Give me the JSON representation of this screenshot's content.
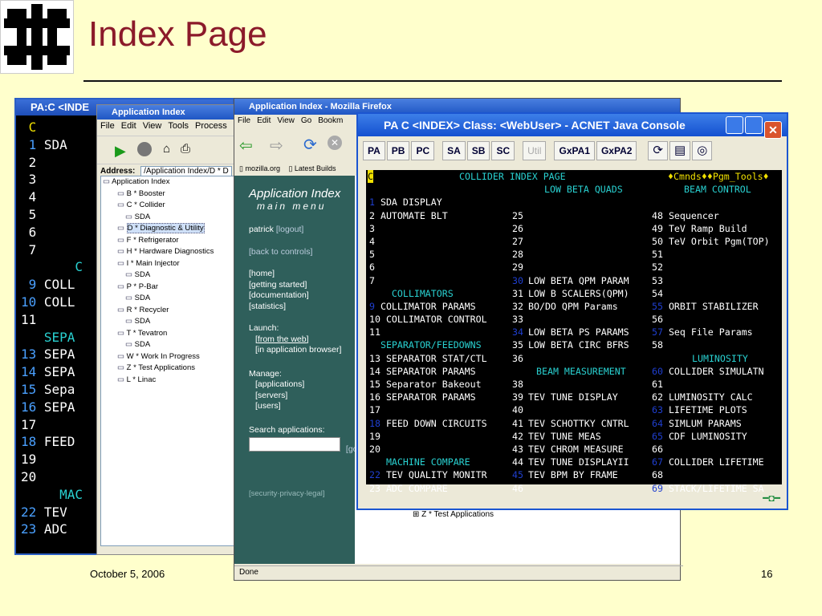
{
  "slide": {
    "title": "Index Page",
    "date": "October 5, 2006",
    "page": "16"
  },
  "console_bg": {
    "title": "PA:C <INDE",
    "lines": [
      {
        "n": "C",
        "t": "",
        "nc": "#f0e000"
      },
      {
        "n": "1",
        "t": " SDA",
        "nc": "#4aa0ff"
      },
      {
        "n": "2",
        "t": "",
        "nc": "#fff"
      },
      {
        "n": "3",
        "t": "",
        "nc": "#fff"
      },
      {
        "n": "4",
        "t": "",
        "nc": "#fff"
      },
      {
        "n": "5",
        "t": "",
        "nc": "#fff"
      },
      {
        "n": "6",
        "t": "",
        "nc": "#fff"
      },
      {
        "n": "7",
        "t": "",
        "nc": "#fff"
      },
      {
        "n": "",
        "t": "       C",
        "nc": "#29d1d1"
      },
      {
        "n": "9",
        "t": " COLL",
        "nc": "#4aa0ff"
      },
      {
        "n": "10",
        "t": " COLL",
        "nc": "#4aa0ff"
      },
      {
        "n": "11",
        "t": "",
        "nc": "#fff"
      },
      {
        "n": "",
        "t": "   SEPA",
        "nc": "#29d1d1"
      },
      {
        "n": "13",
        "t": " SEPA",
        "nc": "#4aa0ff"
      },
      {
        "n": "14",
        "t": " SEPA",
        "nc": "#4aa0ff"
      },
      {
        "n": "15",
        "t": " Sepa",
        "nc": "#4aa0ff"
      },
      {
        "n": "16",
        "t": " SEPA",
        "nc": "#4aa0ff"
      },
      {
        "n": "17",
        "t": "",
        "nc": "#fff"
      },
      {
        "n": "18",
        "t": " FEED",
        "nc": "#4aa0ff"
      },
      {
        "n": "19",
        "t": "",
        "nc": "#fff"
      },
      {
        "n": "20",
        "t": "",
        "nc": "#fff"
      },
      {
        "n": "",
        "t": "     MAC",
        "nc": "#29d1d1"
      },
      {
        "n": "22",
        "t": " TEV",
        "nc": "#4aa0ff"
      },
      {
        "n": "23",
        "t": " ADC",
        "nc": "#4aa0ff"
      }
    ]
  },
  "app_index": {
    "title": "Application Index",
    "menu": [
      "File",
      "Edit",
      "View",
      "Tools",
      "Process"
    ],
    "address_label": "Address:",
    "address_value": "/Application Index/D * D",
    "tree": [
      "Application Index",
      "B * Booster",
      "C * Collider",
      "SDA",
      "D * Diagnostic & Utility",
      "F * Refrigerator",
      "H * Hardware Diagnostics",
      "I * Main Injector",
      "SDA",
      "P * P-Bar",
      "SDA",
      "R * Recycler",
      "SDA",
      "T * Tevatron",
      "SDA",
      "W * Work In Progress",
      "Z * Test Applications",
      "L * Linac"
    ]
  },
  "firefox": {
    "title": "Application Index - Mozilla Firefox",
    "menu": [
      "File",
      "Edit",
      "View",
      "Go",
      "Bookm"
    ],
    "bookmarks": [
      "mozilla.org",
      "Latest Builds"
    ],
    "side_title": "Application Index",
    "side_sub": "main menu",
    "user": "patrick",
    "logout": "[logout]",
    "back": "[back to controls]",
    "links1": [
      "[home]",
      "[getting started]",
      "[documentation]",
      "[statistics]"
    ],
    "launch": "Launch:",
    "launch_links": [
      "[from the web]",
      "[in application browser]"
    ],
    "manage": "Manage:",
    "manage_links": [
      "[applications]",
      "[servers]",
      "[users]"
    ],
    "search": "Search applications:",
    "go": "[go",
    "legal": "[security·privacy·legal]",
    "status": "Done",
    "bottom_item": "Z * Test Applications"
  },
  "acnet": {
    "title": "PA C <INDEX> Class: <WebUser> - ACNET Java Console",
    "buttons": [
      "PA",
      "PB",
      "PC",
      "SA",
      "SB",
      "SC",
      "Util",
      "GxPA1",
      "GxPA2"
    ],
    "header": {
      "c": "C",
      "title": "COLLIDER INDEX PAGE",
      "cmds": "♦Cmnds♦♦Pgm_Tools♦"
    },
    "rows": [
      [
        {
          "t": "",
          "c": "#fff"
        },
        {
          "t": "",
          "c": "#fff"
        },
        {
          "t": "LOW BETA QUADS",
          "c": "#29d1d1"
        },
        {
          "t": "BEAM CONTROL",
          "c": "#29d1d1"
        }
      ],
      [
        {
          "t": "1 SDA DISPLAY",
          "c": "#fff",
          "nb": true
        },
        {
          "t": "",
          "c": "#fff"
        },
        {
          "t": "",
          "c": "#fff"
        },
        {
          "t": "",
          "c": "#fff"
        }
      ],
      [
        {
          "t": "2 AUTOMATE BLT",
          "c": "#fff"
        },
        {
          "t": "25",
          "c": "#fff"
        },
        {
          "t": "",
          "c": "#fff"
        },
        {
          "t": "48 Sequencer",
          "c": "#fff"
        }
      ],
      [
        {
          "t": "3",
          "c": "#fff"
        },
        {
          "t": "26",
          "c": "#fff"
        },
        {
          "t": "",
          "c": "#fff"
        },
        {
          "t": "49 TeV Ramp Build",
          "c": "#fff"
        }
      ],
      [
        {
          "t": "4",
          "c": "#fff"
        },
        {
          "t": "27",
          "c": "#fff"
        },
        {
          "t": "",
          "c": "#fff"
        },
        {
          "t": "50 TeV Orbit Pgm(TOP)",
          "c": "#fff"
        }
      ],
      [
        {
          "t": "5",
          "c": "#fff"
        },
        {
          "t": "28",
          "c": "#fff"
        },
        {
          "t": "",
          "c": "#fff"
        },
        {
          "t": "51",
          "c": "#fff"
        }
      ],
      [
        {
          "t": "6",
          "c": "#fff"
        },
        {
          "t": "29",
          "c": "#fff"
        },
        {
          "t": "",
          "c": "#fff"
        },
        {
          "t": "52",
          "c": "#fff"
        }
      ],
      [
        {
          "t": "7",
          "c": "#fff"
        },
        {
          "t": "30",
          "c": "#1f3fd0"
        },
        {
          "t": "LOW BETA QPM PARAM",
          "c": "#fff"
        },
        {
          "t": "53",
          "c": "#fff"
        }
      ],
      [
        {
          "t": "    COLLIMATORS",
          "c": "#29d1d1"
        },
        {
          "t": "31",
          "c": "#fff"
        },
        {
          "t": "LOW B SCALERS(QPM)",
          "c": "#fff"
        },
        {
          "t": "54",
          "c": "#fff"
        }
      ],
      [
        {
          "t": "9 COLLIMATOR PARAMS",
          "c": "#fff",
          "nb": true
        },
        {
          "t": "32",
          "c": "#fff"
        },
        {
          "t": "BO/DO QPM Params",
          "c": "#fff"
        },
        {
          "t": "55 ORBIT STABILIZER",
          "c": "#fff",
          "nb": true
        }
      ],
      [
        {
          "t": "10 COLLIMATOR CONTROL",
          "c": "#fff"
        },
        {
          "t": "33",
          "c": "#fff"
        },
        {
          "t": "",
          "c": "#fff"
        },
        {
          "t": "56",
          "c": "#fff"
        }
      ],
      [
        {
          "t": "11",
          "c": "#fff"
        },
        {
          "t": "34",
          "c": "#1f3fd0"
        },
        {
          "t": "LOW BETA PS PARAMS",
          "c": "#fff"
        },
        {
          "t": "57 Seq File Params",
          "c": "#fff",
          "nb": true
        }
      ],
      [
        {
          "t": "  SEPARATOR/FEEDOWNS",
          "c": "#29d1d1"
        },
        {
          "t": "35",
          "c": "#fff"
        },
        {
          "t": "LOW BETA CIRC BFRS",
          "c": "#fff"
        },
        {
          "t": "58",
          "c": "#fff"
        }
      ],
      [
        {
          "t": "13 SEPARATOR STAT/CTL",
          "c": "#fff"
        },
        {
          "t": "36",
          "c": "#fff"
        },
        {
          "t": "",
          "c": "#fff"
        },
        {
          "t": "LUMINOSITY",
          "c": "#29d1d1"
        }
      ],
      [
        {
          "t": "14 SEPARATOR PARAMS",
          "c": "#fff"
        },
        {
          "t": "",
          "c": "#fff"
        },
        {
          "t": "BEAM MEASUREMENT",
          "c": "#29d1d1"
        },
        {
          "t": "60 COLLIDER SIMULATN",
          "c": "#fff",
          "nb": true
        }
      ],
      [
        {
          "t": "15 Separator Bakeout",
          "c": "#fff"
        },
        {
          "t": "38",
          "c": "#fff"
        },
        {
          "t": "",
          "c": "#fff"
        },
        {
          "t": "61",
          "c": "#fff"
        }
      ],
      [
        {
          "t": "16 SEPARATOR PARAMS",
          "c": "#fff"
        },
        {
          "t": "39",
          "c": "#fff"
        },
        {
          "t": "TEV TUNE DISPLAY",
          "c": "#fff"
        },
        {
          "t": "62 LUMINOSITY CALC",
          "c": "#fff"
        }
      ],
      [
        {
          "t": "17",
          "c": "#fff"
        },
        {
          "t": "40",
          "c": "#fff"
        },
        {
          "t": "",
          "c": "#fff"
        },
        {
          "t": "63 LIFETIME PLOTS",
          "c": "#fff",
          "nb": true
        }
      ],
      [
        {
          "t": "18 FEED DOWN CIRCUITS",
          "c": "#fff",
          "nb": true
        },
        {
          "t": "41",
          "c": "#fff"
        },
        {
          "t": "TEV SCHOTTKY CNTRL",
          "c": "#fff"
        },
        {
          "t": "64 SIMLUM PARAMS",
          "c": "#fff",
          "nb": true
        }
      ],
      [
        {
          "t": "19",
          "c": "#fff"
        },
        {
          "t": "42",
          "c": "#fff"
        },
        {
          "t": "TEV TUNE MEAS",
          "c": "#fff"
        },
        {
          "t": "65 CDF LUMINOSITY",
          "c": "#fff",
          "nb": true
        }
      ],
      [
        {
          "t": "20",
          "c": "#fff"
        },
        {
          "t": "43",
          "c": "#fff"
        },
        {
          "t": "TEV CHROM MEASURE",
          "c": "#fff"
        },
        {
          "t": "66",
          "c": "#fff"
        }
      ],
      [
        {
          "t": "   MACHINE COMPARE",
          "c": "#29d1d1"
        },
        {
          "t": "44",
          "c": "#fff"
        },
        {
          "t": "TEV TUNE DISPLAYII",
          "c": "#fff"
        },
        {
          "t": "67 COLLIDER LIFETIME",
          "c": "#fff",
          "nb": true
        }
      ],
      [
        {
          "t": "22 TEV QUALITY MONITR",
          "c": "#fff",
          "nb": true
        },
        {
          "t": "45",
          "c": "#1f3fd0"
        },
        {
          "t": "TEV BPM BY FRAME",
          "c": "#fff"
        },
        {
          "t": "68",
          "c": "#fff"
        }
      ],
      [
        {
          "t": "23 ADC COMPARE",
          "c": "#fff"
        },
        {
          "t": "46",
          "c": "#fff"
        },
        {
          "t": "",
          "c": "#fff"
        },
        {
          "t": "69 STACK/LIFETIME SA",
          "c": "#fff",
          "nb": true
        }
      ]
    ]
  }
}
